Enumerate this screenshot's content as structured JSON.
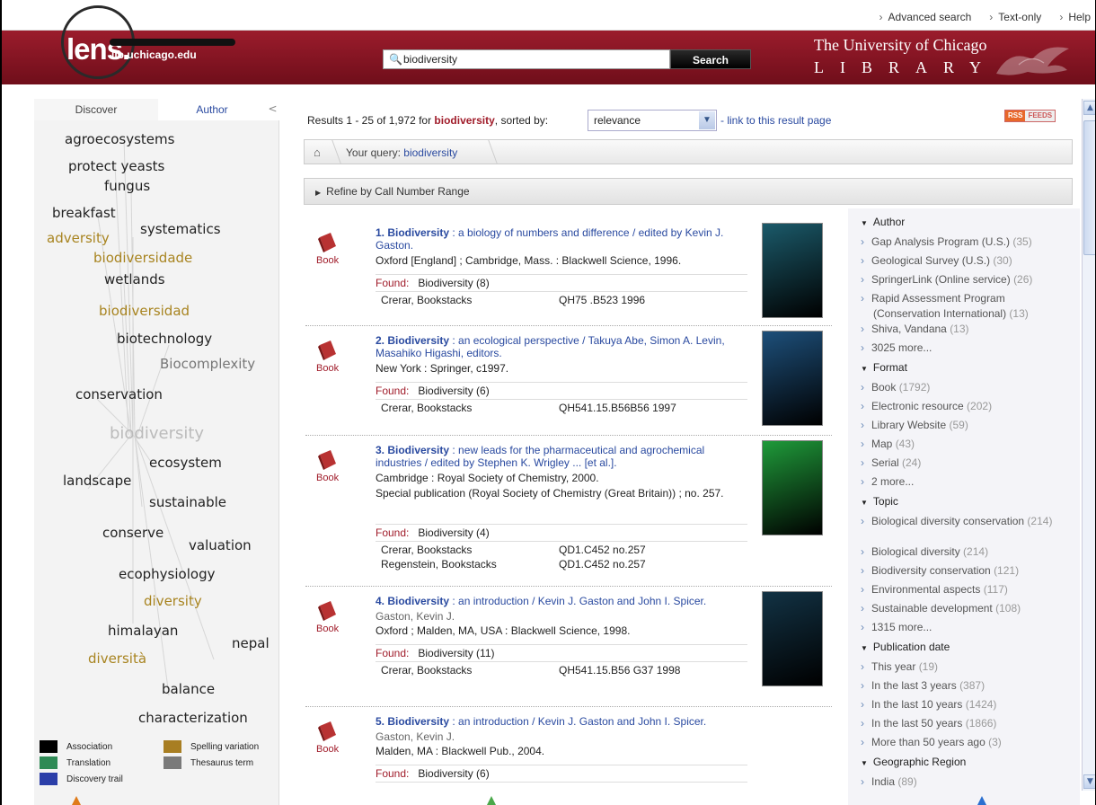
{
  "util_links": [
    "Advanced search",
    "Text-only",
    "Help"
  ],
  "logo": {
    "text": "lens.",
    "url": "lib.uchicago.edu"
  },
  "search": {
    "value": "biodiversity",
    "button": "Search"
  },
  "library": {
    "line1": "The University of Chicago",
    "line2": "LIBRARY"
  },
  "left_tabs": {
    "discover": "Discover",
    "author": "Author",
    "collapse": "<"
  },
  "cloud": [
    {
      "word": "agroecosystems",
      "color": "#222",
      "size": 15
    },
    {
      "word": "protect yeasts",
      "color": "#222",
      "size": 15
    },
    {
      "word": "fungus",
      "color": "#222",
      "size": 15
    },
    {
      "word": "breakfast",
      "color": "#222",
      "size": 15
    },
    {
      "word": "adversity",
      "color": "#a88420",
      "size": 15
    },
    {
      "word": "systematics",
      "color": "#222",
      "size": 15
    },
    {
      "word": "biodiversidade",
      "color": "#a88420",
      "size": 15
    },
    {
      "word": "wetlands",
      "color": "#222",
      "size": 15
    },
    {
      "word": "biodiversidad",
      "color": "#a88420",
      "size": 15
    },
    {
      "word": "biotechnology",
      "color": "#222",
      "size": 15
    },
    {
      "word": "Biocomplexity",
      "color": "#777",
      "size": 15
    },
    {
      "word": "conservation",
      "color": "#222",
      "size": 15
    },
    {
      "word": "biodiversity",
      "color": "#bbb",
      "size": 18
    },
    {
      "word": "ecosystem",
      "color": "#222",
      "size": 15
    },
    {
      "word": "landscape",
      "color": "#222",
      "size": 15
    },
    {
      "word": "sustainable",
      "color": "#222",
      "size": 15
    },
    {
      "word": "conserve",
      "color": "#222",
      "size": 15
    },
    {
      "word": "valuation",
      "color": "#222",
      "size": 15
    },
    {
      "word": "ecophysiology",
      "color": "#222",
      "size": 15
    },
    {
      "word": "diversity",
      "color": "#a88420",
      "size": 15
    },
    {
      "word": "himalayan",
      "color": "#222",
      "size": 15
    },
    {
      "word": "nepal",
      "color": "#222",
      "size": 15
    },
    {
      "word": "diversità",
      "color": "#a88420",
      "size": 15
    },
    {
      "word": "balance",
      "color": "#222",
      "size": 15
    },
    {
      "word": "characterization",
      "color": "#222",
      "size": 15
    }
  ],
  "legend": [
    {
      "label": "Association",
      "color": "#000000"
    },
    {
      "label": "Spelling variation",
      "color": "#a87e22"
    },
    {
      "label": "Translation",
      "color": "#2e8a55"
    },
    {
      "label": "Thesaurus term",
      "color": "#7a7a7a"
    },
    {
      "label": "Discovery trail",
      "color": "#2b3ea8"
    }
  ],
  "results_header": {
    "prefix": "Results 1 - 25 of 1,972 for",
    "query": "biodiversity",
    "sorted_by": ", sorted by:",
    "sort_value": "relevance",
    "link": "- link to this result page",
    "rss": "RSS",
    "feeds": "FEEDS"
  },
  "breadcrumb": {
    "label": "Your query:",
    "query": "biodiversity"
  },
  "refine": "Refine by Call Number Range",
  "results": [
    {
      "num": "1.",
      "title": "Biodiversity",
      "subtitle": ": a biology of numbers and difference / edited by Kevin J. Gaston.",
      "author": "",
      "pub": "Oxford [England] ; Cambridge, Mass. : Blackwell Science, 1996.",
      "series": "",
      "found_label": "Found:",
      "found": "Biodiversity (8)",
      "holdings": [
        {
          "loc": "Crerar, Bookstacks",
          "call": "QH75 .B523 1996"
        }
      ],
      "format": "Book",
      "cover_color": "#1b5a6a"
    },
    {
      "num": "2.",
      "title": "Biodiversity",
      "subtitle": ": an ecological perspective / Takuya Abe, Simon A. Levin, Masahiko Higashi, editors.",
      "author": "",
      "pub": "New York : Springer, c1997.",
      "series": "",
      "found_label": "Found:",
      "found": "Biodiversity (6)",
      "holdings": [
        {
          "loc": "Crerar, Bookstacks",
          "call": "QH541.15.B56B56 1997"
        }
      ],
      "format": "Book",
      "cover_color": "#1d4f7a"
    },
    {
      "num": "3.",
      "title": "Biodiversity",
      "subtitle": ": new leads for the pharmaceutical and agrochemical industries / edited by Stephen K. Wrigley ... [et al.].",
      "author": "",
      "pub": "Cambridge : Royal Society of Chemistry, 2000.",
      "series": "Special publication (Royal Society of Chemistry (Great Britain)) ; no. 257.",
      "found_label": "Found:",
      "found": "Biodiversity (4)",
      "holdings": [
        {
          "loc": "Crerar, Bookstacks",
          "call": "QD1.C452 no.257"
        },
        {
          "loc": "Regenstein, Bookstacks",
          "call": "QD1.C452 no.257"
        }
      ],
      "format": "Book",
      "cover_color": "#1f9a3a"
    },
    {
      "num": "4.",
      "title": "Biodiversity",
      "subtitle": ": an introduction / Kevin J. Gaston and John I. Spicer.",
      "author": "Gaston, Kevin J.",
      "pub": "Oxford ; Malden, MA, USA : Blackwell Science, 1998.",
      "series": "",
      "found_label": "Found:",
      "found": "Biodiversity (11)",
      "holdings": [
        {
          "loc": "Crerar, Bookstacks",
          "call": "QH541.15.B56 G37 1998"
        }
      ],
      "format": "Book",
      "cover_color": "#123244"
    },
    {
      "num": "5.",
      "title": "Biodiversity",
      "subtitle": ": an introduction / Kevin J. Gaston and John I. Spicer.",
      "author": "Gaston, Kevin J.",
      "pub": "Malden, MA : Blackwell Pub., 2004.",
      "series": "",
      "found_label": "Found:",
      "found": "Biodiversity (6)",
      "holdings": [],
      "format": "Book",
      "cover_color": ""
    }
  ],
  "facets": {
    "author": {
      "heading": "Author",
      "items": [
        {
          "label": "Gap Analysis Program (U.S.)",
          "count": "(35)"
        },
        {
          "label": "Geological Survey (U.S.)",
          "count": "(30)"
        },
        {
          "label": "SpringerLink (Online service)",
          "count": "(26)"
        },
        {
          "label": "Rapid Assessment Program (Conservation International)",
          "count": "(13)"
        },
        {
          "label": "Shiva, Vandana",
          "count": "(13)"
        },
        {
          "label": "3025 more...",
          "count": ""
        }
      ]
    },
    "format": {
      "heading": "Format",
      "items": [
        {
          "label": "Book",
          "count": "(1792)"
        },
        {
          "label": "Electronic resource",
          "count": "(202)"
        },
        {
          "label": "Library Website",
          "count": "(59)"
        },
        {
          "label": "Map",
          "count": "(43)"
        },
        {
          "label": "Serial",
          "count": "(24)"
        },
        {
          "label": "2 more...",
          "count": ""
        }
      ]
    },
    "topic": {
      "heading": "Topic",
      "items": [
        {
          "label": "Biological diversity conservation",
          "count": "(214)"
        },
        {
          "label": "Biological diversity",
          "count": "(214)"
        },
        {
          "label": "Biodiversity conservation",
          "count": "(121)"
        },
        {
          "label": "Environmental aspects",
          "count": "(117)"
        },
        {
          "label": "Sustainable development",
          "count": "(108)"
        },
        {
          "label": "1315 more...",
          "count": ""
        }
      ]
    },
    "pubdate": {
      "heading": "Publication date",
      "items": [
        {
          "label": "This year",
          "count": "(19)"
        },
        {
          "label": "In the last 3 years",
          "count": "(387)"
        },
        {
          "label": "In the last 10 years",
          "count": "(1424)"
        },
        {
          "label": "In the last 50 years",
          "count": "(1866)"
        },
        {
          "label": "More than 50 years ago",
          "count": "(3)"
        }
      ]
    },
    "geo": {
      "heading": "Geographic Region",
      "items": [
        {
          "label": "India",
          "count": "(89)"
        }
      ]
    }
  },
  "icons": {
    "search": "magnifier-icon",
    "home": "home-icon",
    "book": "book-icon",
    "rss": "rss-icon"
  }
}
